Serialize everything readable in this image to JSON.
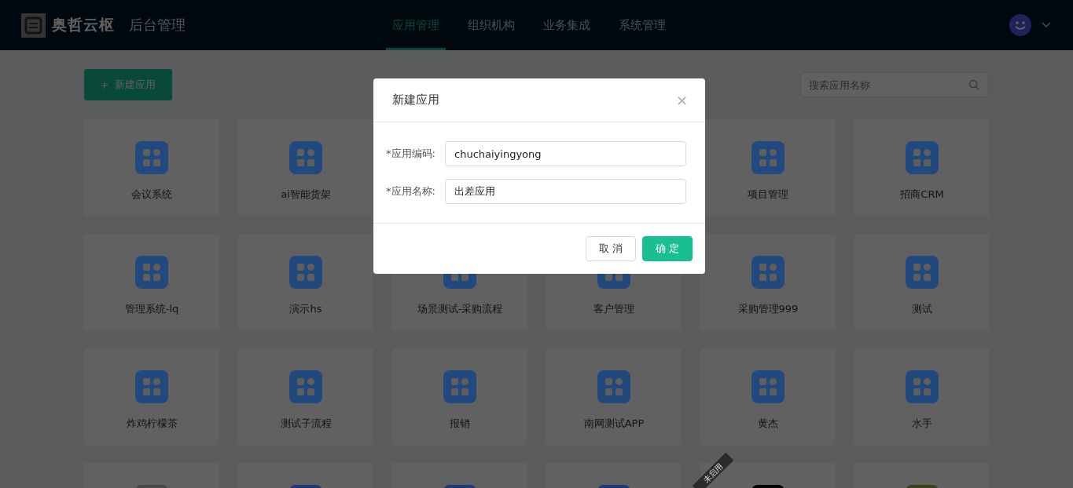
{
  "header": {
    "brand": "奥哲云枢",
    "subtitle": "后台管理",
    "nav": [
      {
        "label": "应用管理",
        "selected": true
      },
      {
        "label": "组织机构",
        "selected": false
      },
      {
        "label": "业务集成",
        "selected": false
      },
      {
        "label": "系统管理",
        "selected": false
      }
    ]
  },
  "toolbar": {
    "new_button": "新建应用",
    "new_icon": "+",
    "search": {
      "placeholder": "搜索应用名称"
    }
  },
  "apps": [
    {
      "name": "会议系统",
      "color": "#21497e"
    },
    {
      "name": "ai智能货架",
      "color": "#21497e"
    },
    {
      "name": "项目管理",
      "color": "#21497e"
    },
    {
      "name": "招商CRM",
      "color": "#21497e"
    },
    {
      "name": "管理系统-lq",
      "color": "#21497e"
    },
    {
      "name": "演示hs",
      "color": "#21497e"
    },
    {
      "name": "场景测试-采购流程",
      "color": "#21497e"
    },
    {
      "name": "客户管理",
      "color": "#21497e"
    },
    {
      "name": "采购管理999",
      "color": "#21497e"
    },
    {
      "name": "测试",
      "color": "#21497e"
    },
    {
      "name": "炸鸡柠檬茶",
      "color": "#21497e"
    },
    {
      "name": "测试子流程",
      "color": "#21497e"
    },
    {
      "name": "报销",
      "color": "#21497e"
    },
    {
      "name": "南网测试APP",
      "color": "#21497e"
    },
    {
      "name": "黄杰",
      "color": "#21497e"
    },
    {
      "name": "水手",
      "color": "#21497e"
    },
    {
      "color": "#484848"
    },
    {
      "color": "#1f3a7a"
    },
    {
      "color": "#1f3a7a"
    },
    {
      "color": "#1f3a7a"
    },
    {
      "color": "#000000",
      "badge": "未启用"
    },
    {
      "color": "#3d3e1a"
    }
  ],
  "dialog": {
    "title": "新建应用",
    "close": "×",
    "fields": [
      {
        "label": "*应用编码:",
        "value": "chuchaiyingyong"
      },
      {
        "label": "*应用名称:",
        "value": "出差应用"
      }
    ],
    "cancel": "取 消",
    "ok": "确 定"
  }
}
